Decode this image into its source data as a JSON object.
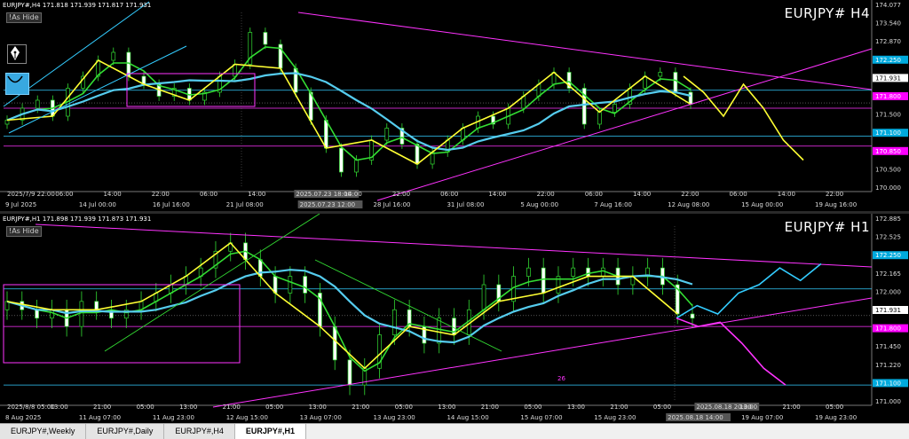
{
  "colors": {
    "background": "#000000",
    "trendline": "#ff33ff",
    "channel_line": "#33ccff",
    "price_line_cyan": "#33ccff",
    "zigzag": "#ffff33",
    "ma_fast": "#33dd33",
    "ma_slow": "#55ccee",
    "current_price_tag": "#ff00ff",
    "level_tag": "#00aadd"
  },
  "icons": {
    "pen": "fountain-pen-icon",
    "face": "smile-face-icon"
  },
  "panes": [
    {
      "id": "h4",
      "header": "EURJPY#,H4  171.818 171.939 171.817 171.931",
      "tag": "!As Hide",
      "title": "EURJPY# H4",
      "right_axis": [
        {
          "label": "174.077",
          "style": "plain"
        },
        {
          "label": "173.540",
          "style": "plain"
        },
        {
          "label": "172.870",
          "style": "plain"
        },
        {
          "label": "172.250",
          "style": "cyan"
        },
        {
          "label": "171.931",
          "style": "white"
        },
        {
          "label": "171.800",
          "style": "magenta"
        },
        {
          "label": "171.500",
          "style": "plain"
        },
        {
          "label": "171.100",
          "style": "cyan"
        },
        {
          "label": "170.850",
          "style": "magenta"
        },
        {
          "label": "170.500",
          "style": "plain"
        },
        {
          "label": "170.000",
          "style": "plain"
        }
      ],
      "time_axis_top": [
        "2025/7/9 22:00",
        "06:00",
        "14:00",
        "22:00",
        "06:00",
        "14:00",
        "2025.07.23 18:00",
        "14:00",
        "22:00",
        "06:00",
        "14:00",
        "22:00",
        "06:00",
        "14:00",
        "22:00",
        "06:00",
        "14:00",
        "22:00"
      ],
      "time_axis_bottom": [
        "9 Jul 2025",
        "14 Jul 00:00",
        "16 Jul 16:00",
        "21 Jul 08:00",
        "2025.07.23 12:00",
        "28 Jul 16:00",
        "31 Jul 08:00",
        "5 Aug 00:00",
        "7 Aug 16:00",
        "12 Aug 08:00",
        "15 Aug 00:00",
        "19 Aug 16:00"
      ]
    },
    {
      "id": "h1",
      "header": "EURJPY#,H1  171.898 171.939 171.873 171.931",
      "tag": "!As Hide",
      "title": "EURJPY# H1",
      "right_axis": [
        {
          "label": "172.885",
          "style": "plain"
        },
        {
          "label": "172.525",
          "style": "plain"
        },
        {
          "label": "172.250",
          "style": "cyan"
        },
        {
          "label": "172.165",
          "style": "plain"
        },
        {
          "label": "172.000",
          "style": "plain"
        },
        {
          "label": "171.931",
          "style": "white"
        },
        {
          "label": "171.800",
          "style": "magenta"
        },
        {
          "label": "171.450",
          "style": "plain"
        },
        {
          "label": "171.220",
          "style": "plain"
        },
        {
          "label": "171.100",
          "style": "cyan"
        },
        {
          "label": "171.000",
          "style": "plain"
        }
      ],
      "time_axis_top": [
        "2025/8/8 05:00",
        "13:00",
        "21:00",
        "05:00",
        "13:00",
        "21:00",
        "05:00",
        "13:00",
        "21:00",
        "05:00",
        "13:00",
        "21:00",
        "05:00",
        "13:00",
        "21:00",
        "05:00",
        "2025.08.18 20:00",
        "13:00",
        "21:00",
        "05:00"
      ],
      "time_axis_bottom": [
        "8 Aug 2025",
        "11 Aug 07:00",
        "11 Aug 23:00",
        "12 Aug 15:00",
        "13 Aug 07:00",
        "13 Aug 23:00",
        "14 Aug 15:00",
        "15 Aug 07:00",
        "15 Aug 23:00",
        "2025.08.18 14:00",
        "19 Aug 07:00",
        "19 Aug 23:00"
      ],
      "marker": "26"
    }
  ],
  "tabs": [
    "EURJPY#,Weekly",
    "EURJPY#,Daily",
    "EURJPY#,H4",
    "EURJPY#,H1"
  ],
  "active_tab": "EURJPY#,H1",
  "chart_data": [
    {
      "type": "candlestick",
      "symbol": "EURJPY#",
      "timeframe": "H4",
      "ohlc_header": {
        "open": 171.818,
        "high": 171.939,
        "low": 171.817,
        "close": 171.931
      },
      "ylim": [
        169.8,
        174.2
      ],
      "price_levels": [
        172.25,
        171.8,
        171.1,
        170.85
      ],
      "current_price": 171.931,
      "close_series": [
        171.5,
        171.8,
        172.0,
        171.6,
        172.3,
        172.6,
        173.0,
        173.2,
        172.6,
        172.4,
        172.1,
        172.3,
        172.0,
        172.2,
        172.6,
        172.9,
        173.7,
        173.4,
        172.8,
        172.2,
        171.5,
        170.8,
        170.2,
        170.5,
        171.0,
        171.3,
        170.9,
        170.4,
        170.7,
        171.0,
        171.3,
        171.6,
        171.4,
        171.8,
        172.1,
        172.4,
        172.7,
        172.3,
        171.4,
        171.7,
        171.9,
        172.3,
        172.6,
        172.7,
        172.2,
        171.9
      ],
      "zigzag_projection": [
        172.6,
        172.2,
        171.6,
        172.4,
        171.8,
        171.0,
        170.5
      ]
    },
    {
      "type": "candlestick",
      "symbol": "EURJPY#",
      "timeframe": "H1",
      "ohlc_header": {
        "open": 171.898,
        "high": 171.939,
        "low": 171.873,
        "close": 171.931
      },
      "ylim": [
        170.9,
        173.0
      ],
      "price_levels": [
        172.25,
        171.8,
        171.1
      ],
      "current_price": 171.931,
      "close_series": [
        172.1,
        172.0,
        171.9,
        172.0,
        171.8,
        172.1,
        172.0,
        171.9,
        172.0,
        172.1,
        172.2,
        172.3,
        172.4,
        172.5,
        172.7,
        172.8,
        172.6,
        172.4,
        172.2,
        172.4,
        172.2,
        171.8,
        171.4,
        171.1,
        171.3,
        171.7,
        172.0,
        171.8,
        171.6,
        171.9,
        171.7,
        172.0,
        172.3,
        172.1,
        172.4,
        172.5,
        172.2,
        172.4,
        172.5,
        172.4,
        172.5,
        172.3,
        172.4,
        172.5,
        172.3,
        171.95,
        171.9
      ],
      "bullish_projection": [
        171.9,
        172.05,
        171.95,
        172.2,
        172.3,
        172.5,
        172.35,
        172.55
      ],
      "bearish_projection": [
        171.9,
        171.8,
        171.85,
        171.6,
        171.3,
        171.1
      ]
    }
  ]
}
